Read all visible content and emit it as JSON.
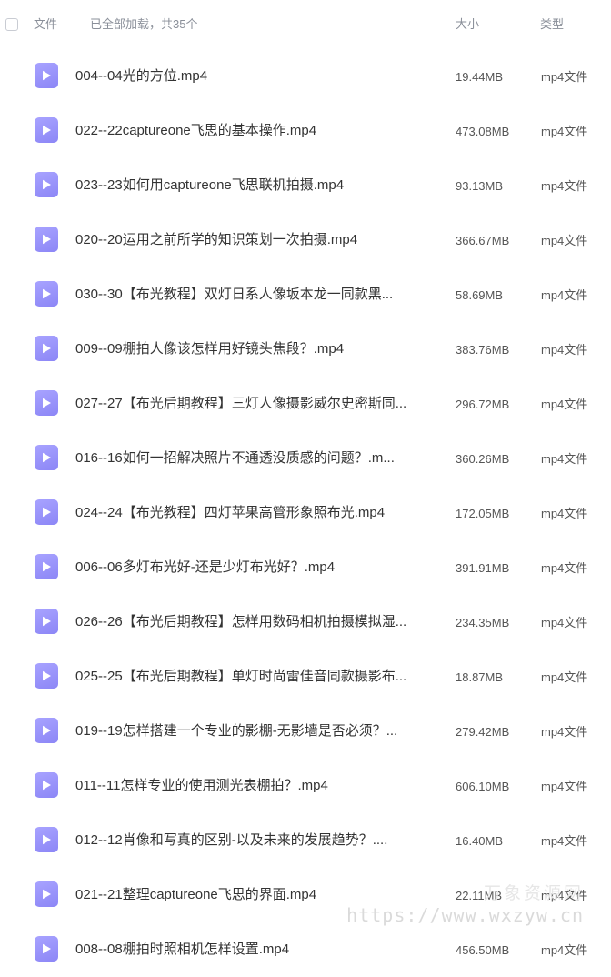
{
  "header": {
    "name_col": "文件",
    "status": "已全部加载，共35个",
    "size_col": "大小",
    "type_col": "类型"
  },
  "files": [
    {
      "name": "004--04光的方位.mp4",
      "size": "19.44MB",
      "type": "mp4文件"
    },
    {
      "name": "022--22captureone飞思的基本操作.mp4",
      "size": "473.08MB",
      "type": "mp4文件"
    },
    {
      "name": "023--23如何用captureone飞思联机拍摄.mp4",
      "size": "93.13MB",
      "type": "mp4文件"
    },
    {
      "name": "020--20运用之前所学的知识策划一次拍摄.mp4",
      "size": "366.67MB",
      "type": "mp4文件"
    },
    {
      "name": "030--30【布光教程】双灯日系人像坂本龙一同款黑...",
      "size": "58.69MB",
      "type": "mp4文件"
    },
    {
      "name": "009--09棚拍人像该怎样用好镜头焦段？.mp4",
      "size": "383.76MB",
      "type": "mp4文件"
    },
    {
      "name": "027--27【布光后期教程】三灯人像摄影威尔史密斯同...",
      "size": "296.72MB",
      "type": "mp4文件"
    },
    {
      "name": "016--16如何一招解决照片不通透没质感的问题？.m...",
      "size": "360.26MB",
      "type": "mp4文件"
    },
    {
      "name": "024--24【布光教程】四灯苹果高管形象照布光.mp4",
      "size": "172.05MB",
      "type": "mp4文件"
    },
    {
      "name": "006--06多灯布光好-还是少灯布光好？.mp4",
      "size": "391.91MB",
      "type": "mp4文件"
    },
    {
      "name": "026--26【布光后期教程】怎样用数码相机拍摄模拟湿...",
      "size": "234.35MB",
      "type": "mp4文件"
    },
    {
      "name": "025--25【布光后期教程】单灯时尚雷佳音同款摄影布...",
      "size": "18.87MB",
      "type": "mp4文件"
    },
    {
      "name": "019--19怎样搭建一个专业的影棚-无影墙是否必须？...",
      "size": "279.42MB",
      "type": "mp4文件"
    },
    {
      "name": "011--11怎样专业的使用测光表棚拍？.mp4",
      "size": "606.10MB",
      "type": "mp4文件"
    },
    {
      "name": "012--12肖像和写真的区别-以及未来的发展趋势？....",
      "size": "16.40MB",
      "type": "mp4文件"
    },
    {
      "name": "021--21整理captureone飞思的界面.mp4",
      "size": "22.11MB",
      "type": "mp4文件"
    },
    {
      "name": "008--08棚拍时照相机怎样设置.mp4",
      "size": "456.50MB",
      "type": "mp4文件"
    }
  ],
  "watermark": {
    "line1": "万象资源网",
    "line2": "https://www.wxzyw.cn"
  },
  "colors": {
    "icon": "#9a95fb",
    "header_text": "#8a8f99"
  },
  "icons": {
    "file": "play-file-icon"
  }
}
